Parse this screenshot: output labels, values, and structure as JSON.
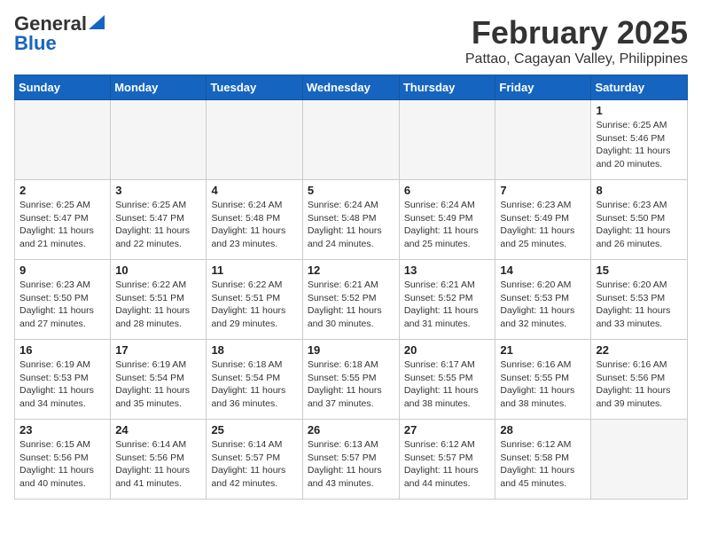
{
  "header": {
    "logo_general": "General",
    "logo_blue": "Blue",
    "month_title": "February 2025",
    "subtitle": "Pattao, Cagayan Valley, Philippines"
  },
  "weekdays": [
    "Sunday",
    "Monday",
    "Tuesday",
    "Wednesday",
    "Thursday",
    "Friday",
    "Saturday"
  ],
  "weeks": [
    [
      {
        "day": "",
        "info": ""
      },
      {
        "day": "",
        "info": ""
      },
      {
        "day": "",
        "info": ""
      },
      {
        "day": "",
        "info": ""
      },
      {
        "day": "",
        "info": ""
      },
      {
        "day": "",
        "info": ""
      },
      {
        "day": "1",
        "info": "Sunrise: 6:25 AM\nSunset: 5:46 PM\nDaylight: 11 hours and 20 minutes."
      }
    ],
    [
      {
        "day": "2",
        "info": "Sunrise: 6:25 AM\nSunset: 5:47 PM\nDaylight: 11 hours and 21 minutes."
      },
      {
        "day": "3",
        "info": "Sunrise: 6:25 AM\nSunset: 5:47 PM\nDaylight: 11 hours and 22 minutes."
      },
      {
        "day": "4",
        "info": "Sunrise: 6:24 AM\nSunset: 5:48 PM\nDaylight: 11 hours and 23 minutes."
      },
      {
        "day": "5",
        "info": "Sunrise: 6:24 AM\nSunset: 5:48 PM\nDaylight: 11 hours and 24 minutes."
      },
      {
        "day": "6",
        "info": "Sunrise: 6:24 AM\nSunset: 5:49 PM\nDaylight: 11 hours and 25 minutes."
      },
      {
        "day": "7",
        "info": "Sunrise: 6:23 AM\nSunset: 5:49 PM\nDaylight: 11 hours and 25 minutes."
      },
      {
        "day": "8",
        "info": "Sunrise: 6:23 AM\nSunset: 5:50 PM\nDaylight: 11 hours and 26 minutes."
      }
    ],
    [
      {
        "day": "9",
        "info": "Sunrise: 6:23 AM\nSunset: 5:50 PM\nDaylight: 11 hours and 27 minutes."
      },
      {
        "day": "10",
        "info": "Sunrise: 6:22 AM\nSunset: 5:51 PM\nDaylight: 11 hours and 28 minutes."
      },
      {
        "day": "11",
        "info": "Sunrise: 6:22 AM\nSunset: 5:51 PM\nDaylight: 11 hours and 29 minutes."
      },
      {
        "day": "12",
        "info": "Sunrise: 6:21 AM\nSunset: 5:52 PM\nDaylight: 11 hours and 30 minutes."
      },
      {
        "day": "13",
        "info": "Sunrise: 6:21 AM\nSunset: 5:52 PM\nDaylight: 11 hours and 31 minutes."
      },
      {
        "day": "14",
        "info": "Sunrise: 6:20 AM\nSunset: 5:53 PM\nDaylight: 11 hours and 32 minutes."
      },
      {
        "day": "15",
        "info": "Sunrise: 6:20 AM\nSunset: 5:53 PM\nDaylight: 11 hours and 33 minutes."
      }
    ],
    [
      {
        "day": "16",
        "info": "Sunrise: 6:19 AM\nSunset: 5:53 PM\nDaylight: 11 hours and 34 minutes."
      },
      {
        "day": "17",
        "info": "Sunrise: 6:19 AM\nSunset: 5:54 PM\nDaylight: 11 hours and 35 minutes."
      },
      {
        "day": "18",
        "info": "Sunrise: 6:18 AM\nSunset: 5:54 PM\nDaylight: 11 hours and 36 minutes."
      },
      {
        "day": "19",
        "info": "Sunrise: 6:18 AM\nSunset: 5:55 PM\nDaylight: 11 hours and 37 minutes."
      },
      {
        "day": "20",
        "info": "Sunrise: 6:17 AM\nSunset: 5:55 PM\nDaylight: 11 hours and 38 minutes."
      },
      {
        "day": "21",
        "info": "Sunrise: 6:16 AM\nSunset: 5:55 PM\nDaylight: 11 hours and 38 minutes."
      },
      {
        "day": "22",
        "info": "Sunrise: 6:16 AM\nSunset: 5:56 PM\nDaylight: 11 hours and 39 minutes."
      }
    ],
    [
      {
        "day": "23",
        "info": "Sunrise: 6:15 AM\nSunset: 5:56 PM\nDaylight: 11 hours and 40 minutes."
      },
      {
        "day": "24",
        "info": "Sunrise: 6:14 AM\nSunset: 5:56 PM\nDaylight: 11 hours and 41 minutes."
      },
      {
        "day": "25",
        "info": "Sunrise: 6:14 AM\nSunset: 5:57 PM\nDaylight: 11 hours and 42 minutes."
      },
      {
        "day": "26",
        "info": "Sunrise: 6:13 AM\nSunset: 5:57 PM\nDaylight: 11 hours and 43 minutes."
      },
      {
        "day": "27",
        "info": "Sunrise: 6:12 AM\nSunset: 5:57 PM\nDaylight: 11 hours and 44 minutes."
      },
      {
        "day": "28",
        "info": "Sunrise: 6:12 AM\nSunset: 5:58 PM\nDaylight: 11 hours and 45 minutes."
      },
      {
        "day": "",
        "info": ""
      }
    ]
  ]
}
